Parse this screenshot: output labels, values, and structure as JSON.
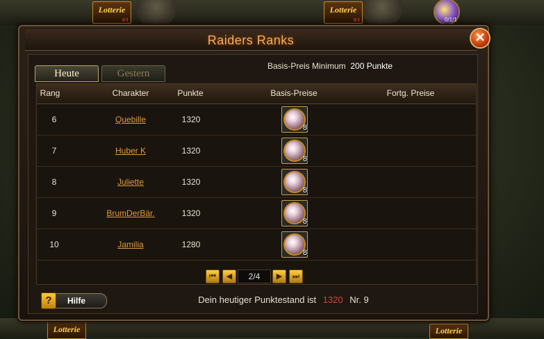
{
  "background": {
    "lotterie_top_left": {
      "label": "Lotterie",
      "count": "0/1"
    },
    "lotterie_top_right": {
      "label": "Lotterie",
      "count": "0/1"
    },
    "orb_counter": "0/1/1",
    "lotterie_bottom_left": {
      "label": "Lotterie"
    },
    "lotterie_bottom_right": {
      "label": "Lotterie"
    }
  },
  "dialog": {
    "title": "Raiders Ranks",
    "close_label": "✕"
  },
  "min_price": {
    "label": "Basis-Preis Minimum",
    "value": "200 Punkte"
  },
  "tabs": [
    {
      "label": "Heute",
      "active": true
    },
    {
      "label": "Gestern",
      "active": false
    }
  ],
  "table": {
    "headers": [
      "Rang",
      "Charakter",
      "Punkte",
      "Basis-Preise",
      "Fortg. Preise"
    ],
    "rows": [
      {
        "rank": "6",
        "name": "Quebille",
        "points": "1320",
        "prize_count": "8"
      },
      {
        "rank": "7",
        "name": "Huber K",
        "points": "1320",
        "prize_count": "8"
      },
      {
        "rank": "8",
        "name": "Juliette",
        "points": "1320",
        "prize_count": "8"
      },
      {
        "rank": "9",
        "name": "BrumDerBär.",
        "points": "1320",
        "prize_count": "8"
      },
      {
        "rank": "10",
        "name": "Jamilia",
        "points": "1280",
        "prize_count": "8"
      }
    ]
  },
  "pager": {
    "display": "2/4",
    "first": "⏮",
    "prev": "◀",
    "next": "▶",
    "last": "⏭"
  },
  "footer": {
    "help_icon": "?",
    "help_label": "Hilfe",
    "score_text": "Dein heutiger Punktestand ist",
    "score_points": "1320",
    "score_rank": "Nr. 9"
  },
  "colors": {
    "accent": "#f0b060",
    "link": "#e09a40",
    "points_red": "#d04838"
  },
  "icons": [
    "close-icon",
    "pearl-icon",
    "first-page-icon",
    "prev-page-icon",
    "next-page-icon",
    "last-page-icon",
    "help-icon"
  ]
}
